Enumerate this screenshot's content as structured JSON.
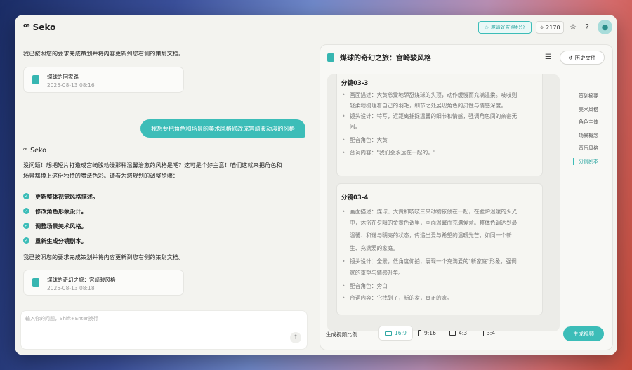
{
  "header": {
    "logo_text": "Seko",
    "invite_label": "邀请好友得积分",
    "credits": "2170"
  },
  "chat": {
    "msg1": "我已按照您的要求完成策划并将内容更新到您右侧的策划文档。",
    "card1": {
      "title": "煤球的回家路",
      "date": "2025-08-13 08:16"
    },
    "user_msg": "我想要把角色和场景的美术风格修改成宫崎骏动漫的风格",
    "bot_name": "Seko",
    "bot_intro_line1": "没问题！想把短片打造成宫崎骏动漫那种温馨治愈的风格是吧？这可是个好主意！咱们这就来把角色和",
    "bot_intro_line2": "场景都换上这份独特的魔法色彩。请看为您规划的调整步骤：",
    "steps": [
      "更新整体视觉风格描述。",
      "修改角色形象设计。",
      "调整场景美术风格。",
      "重新生成分镜剧本。"
    ],
    "msg2": "我已按照您的要求完成策划并将内容更新到您右侧的策划文档。",
    "card2": {
      "title": "煤球的奇幻之旅：宫崎骏风格",
      "date": "2025-08-13 08:18"
    },
    "input_placeholder": "输入你的问题，Shift+Enter换行"
  },
  "panel": {
    "title": "煤球的奇幻之旅：宫崎骏风格",
    "history_label": "历史文件",
    "scenes": [
      {
        "title": "分镜03-3",
        "lines": [
          "画面描述：大黄慈爱地舔舐煤球的头顶，动作缓慢而充满温柔。吱吱则",
          "轻柔地梳理着自己的羽毛，细节之处展现角色的灵性与情感深度。",
          "镜头设计：特写，近距离捕捉温馨的细节和情感，强调角色间的亲密无",
          "间。",
          "配音角色：大黄",
          "台词内容：\"我们会永远在一起的。\""
        ]
      },
      {
        "title": "分镜03-4",
        "lines": [
          "画面描述：煤球、大黄和吱吱三只动物依偎在一起，在壁炉温暖的火光",
          "中，沐浴在夕阳的金黄色调里，画面温馨而充满爱意。整体色调达到最",
          "温馨、和谐与明亮的状态，传递出爱与希望的温暖光芒，如同一个新",
          "生、充满爱的家庭。",
          "镜头设计：全景，低角度仰拍，展现一个充满爱的\"新家庭\"形象，强调",
          "家的重塑与情感升华。",
          "配音角色：旁白",
          "台词内容：它找到了，新的家，真正的家。"
        ]
      }
    ],
    "toc": [
      "策划摘要",
      "美术风格",
      "角色主体",
      "场景概念",
      "音乐风格",
      "分镜剧本"
    ],
    "ratio_label": "生成视频比例",
    "ratios": [
      "16:9",
      "9:16",
      "4:3",
      "3:4"
    ],
    "generate_label": "生成视频"
  }
}
